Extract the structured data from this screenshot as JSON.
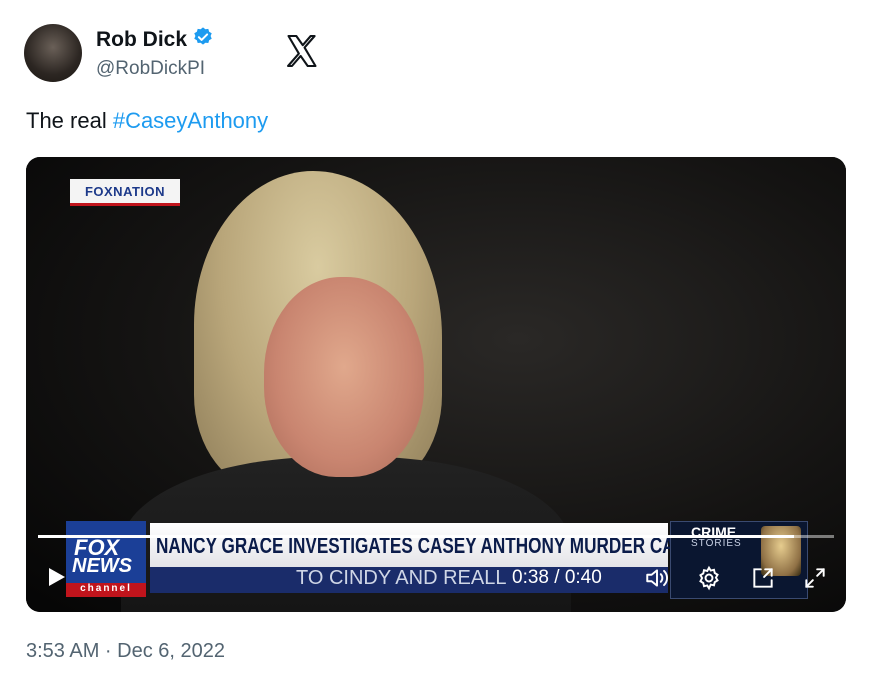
{
  "author": {
    "name": "Rob Dick",
    "handle": "@RobDickPI",
    "verified_color": "#1d9bf0"
  },
  "tweet": {
    "text_prefix": "The real ",
    "hashtag": "#CaseyAnthony",
    "timestamp": "3:53 AM · Dec 6, 2022"
  },
  "video": {
    "corner_logo": "FOXNATION",
    "chyron": "NANCY GRACE INVESTIGATES CASEY ANTHONY MURDER CASE",
    "subtitle": "TO CINDY AND REALL",
    "network_logo_line1": "FOX",
    "network_logo_line2": "NEWS",
    "network_logo_line3": "channel",
    "promo_title": "CRIME",
    "promo_subtitle": "STORIES",
    "time_display": "0:38 / 0:40",
    "progress": 0.95,
    "icons": [
      "play-icon",
      "volume-icon",
      "settings-icon",
      "pip-icon",
      "fullscreen-icon"
    ]
  },
  "colors": {
    "link": "#1d9bf0",
    "secondary_text": "#536471"
  }
}
